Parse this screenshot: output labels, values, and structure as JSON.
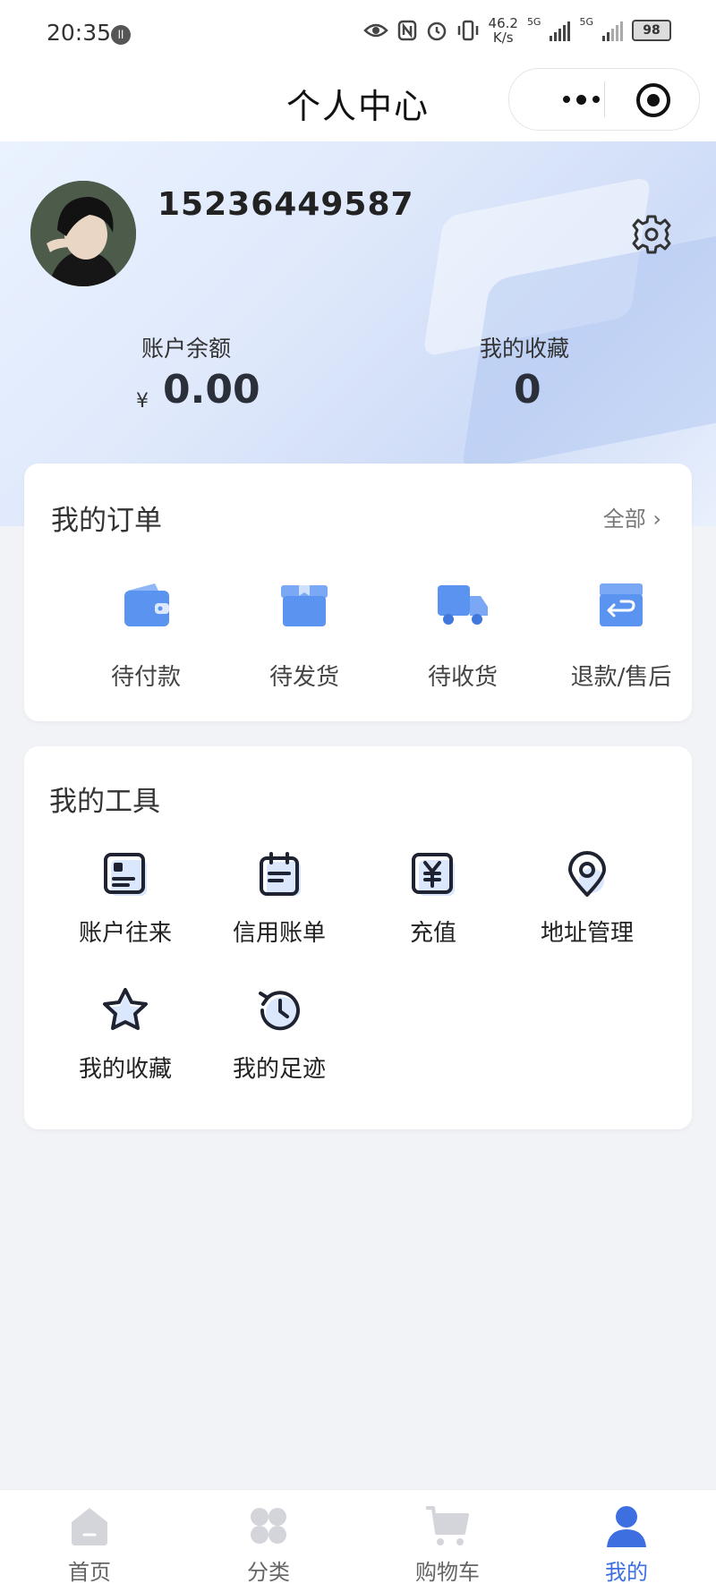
{
  "status_bar": {
    "time": "20:35",
    "net_speed_value": "46.2",
    "net_speed_unit": "K/s",
    "signal1": "5G",
    "signal2": "5G",
    "battery": "98"
  },
  "nav": {
    "title": "个人中心"
  },
  "profile": {
    "phone": "15236449587"
  },
  "stats": {
    "balance_label": "账户余额",
    "currency": "¥",
    "balance_value": "0.00",
    "favorites_label": "我的收藏",
    "favorites_value": "0"
  },
  "orders": {
    "title": "我的订单",
    "all_label": "全部",
    "items": [
      {
        "label": "待付款",
        "icon": "wallet-icon"
      },
      {
        "label": "待发货",
        "icon": "box-icon"
      },
      {
        "label": "待收货",
        "icon": "truck-icon"
      },
      {
        "label": "退款/售后",
        "icon": "refund-icon"
      }
    ]
  },
  "tools": {
    "title": "我的工具",
    "items": [
      {
        "label": "账户往来",
        "icon": "ledger-icon"
      },
      {
        "label": "信用账单",
        "icon": "calendar-bill-icon"
      },
      {
        "label": "充值",
        "icon": "yen-icon"
      },
      {
        "label": "地址管理",
        "icon": "location-pin-icon"
      },
      {
        "label": "我的收藏",
        "icon": "star-icon"
      },
      {
        "label": "我的足迹",
        "icon": "history-icon"
      }
    ]
  },
  "tabbar": {
    "items": [
      {
        "label": "首页",
        "icon": "home-icon"
      },
      {
        "label": "分类",
        "icon": "category-icon"
      },
      {
        "label": "购物车",
        "icon": "cart-icon"
      },
      {
        "label": "我的",
        "icon": "user-icon",
        "active": true
      }
    ],
    "active_color": "#3d6fe0"
  },
  "colors": {
    "accent": "#3d6fe0",
    "icon_blue": "#5b93f0",
    "background": "#f2f3f7"
  }
}
